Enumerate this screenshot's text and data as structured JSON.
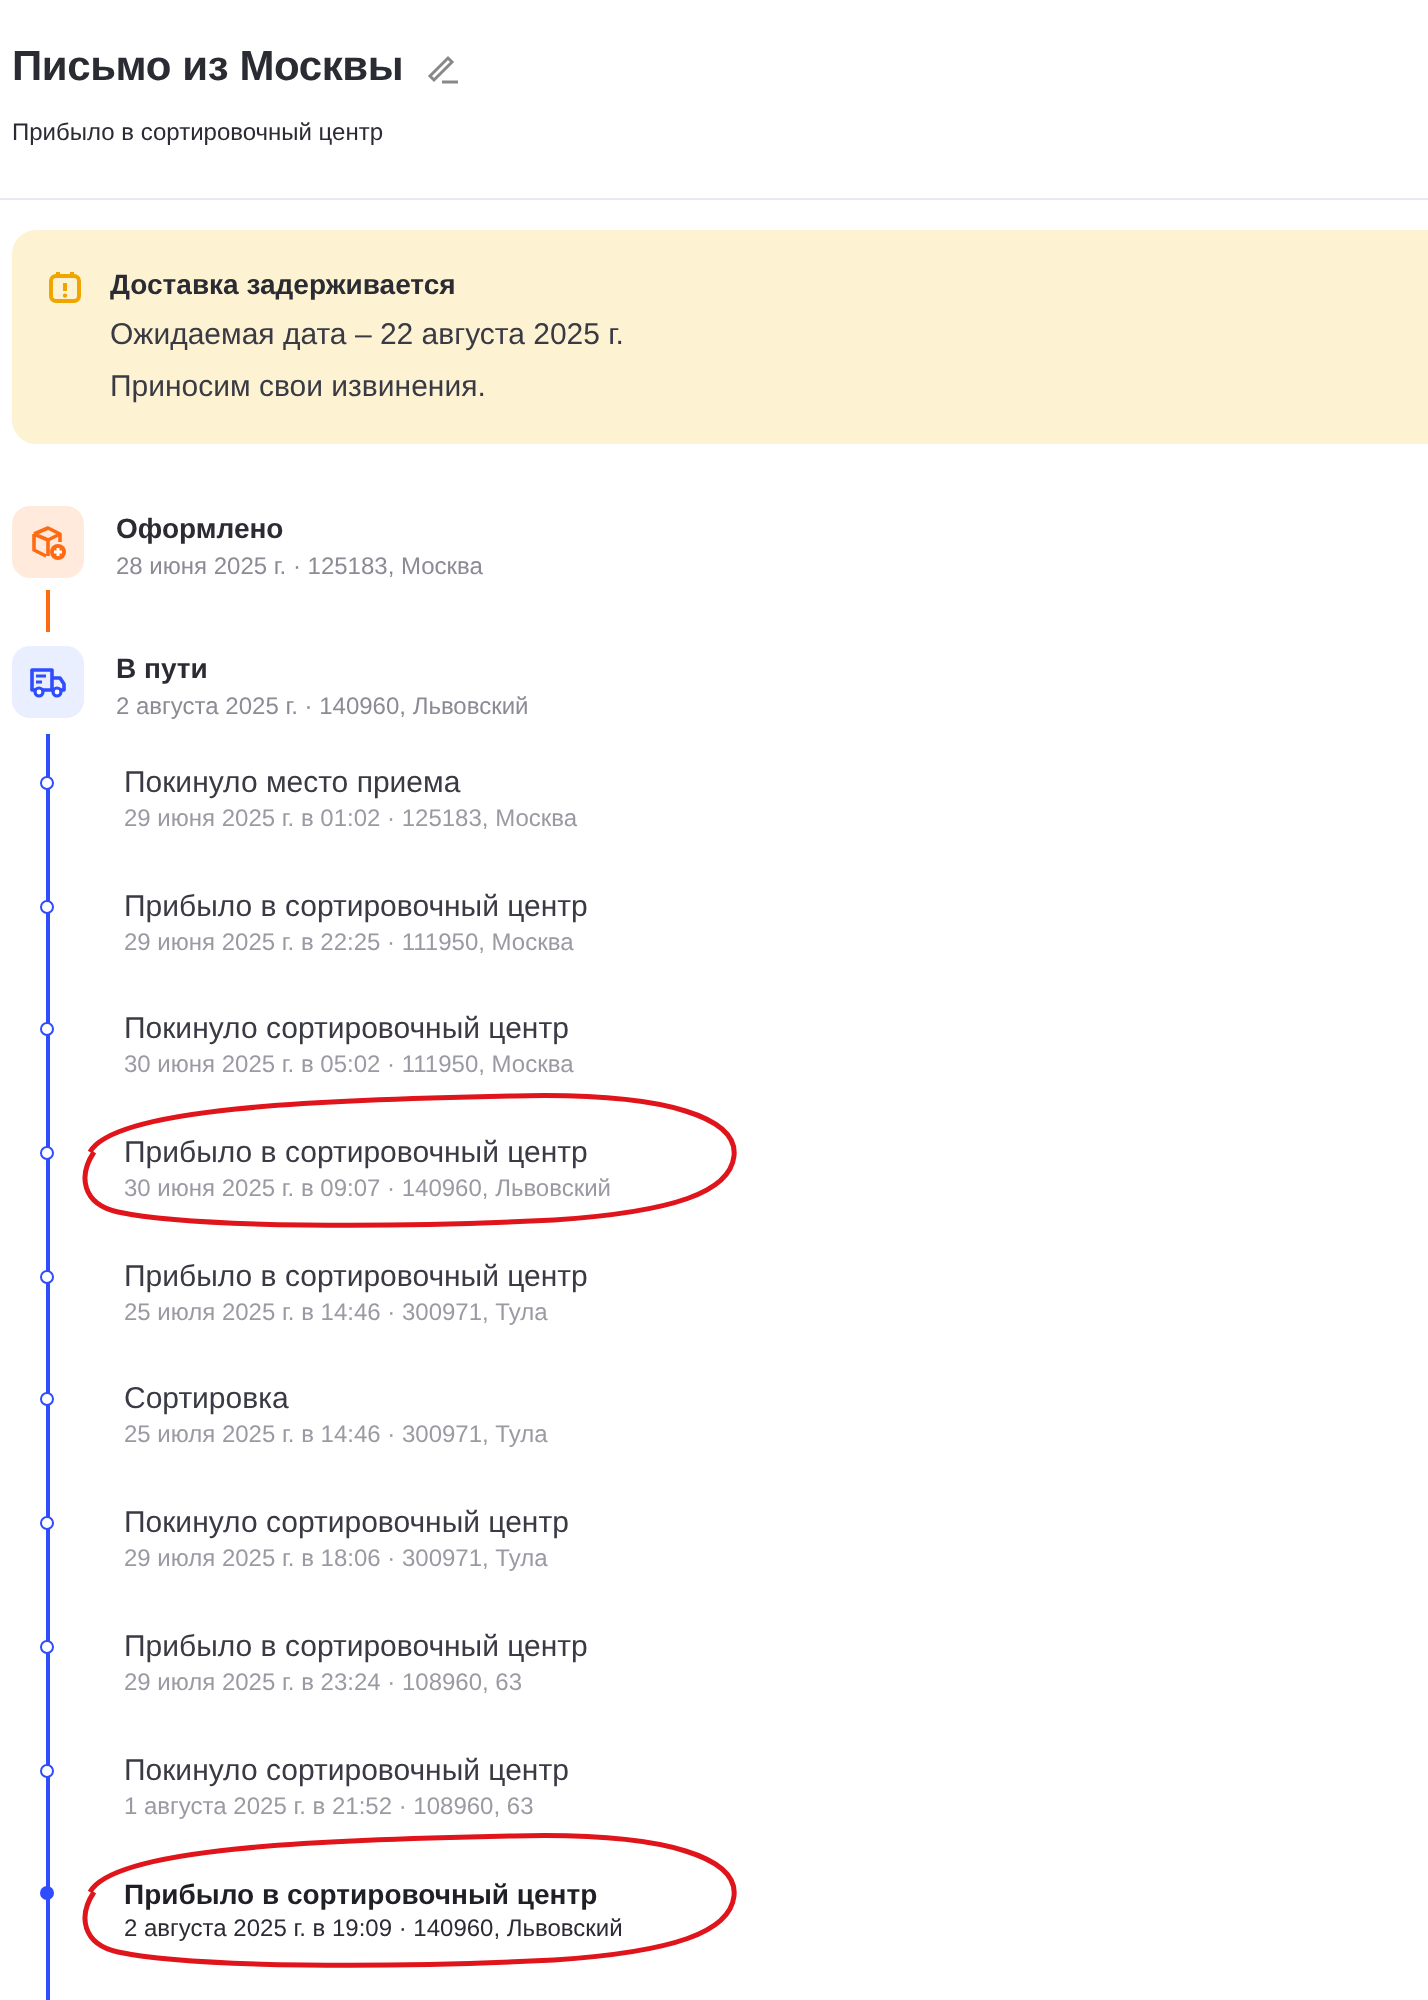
{
  "header": {
    "title": "Письмо из Москвы",
    "subtitle": "Прибыло в сортировочный центр"
  },
  "alert": {
    "title": "Доставка задерживается",
    "lines": [
      "Ожидаемая дата – 22 августа 2025 г.",
      "Приносим свои извинения."
    ]
  },
  "stages": [
    {
      "kind": "created",
      "title": "Оформлено",
      "details": "28 июня 2025 г. · 125183, Москва"
    },
    {
      "kind": "transit",
      "title": "В пути",
      "details": "2 августа 2025 г. · 140960, Львовский"
    }
  ],
  "events": [
    {
      "title": "Покинуло место приема",
      "details": "29 июня 2025 г. в 01:02 · 125183, Москва",
      "current": false,
      "circled": false
    },
    {
      "title": "Прибыло в сортировочный центр",
      "details": "29 июня 2025 г. в 22:25 · 111950, Москва",
      "current": false,
      "circled": false
    },
    {
      "title": "Покинуло сортировочный центр",
      "details": "30 июня 2025 г. в 05:02 · 111950, Москва",
      "current": false,
      "circled": false
    },
    {
      "title": "Прибыло в сортировочный центр",
      "details": "30 июня 2025 г. в 09:07 · 140960, Львовский",
      "current": false,
      "circled": true
    },
    {
      "title": "Прибыло в сортировочный центр",
      "details": "25 июля 2025 г. в 14:46 · 300971, Тула",
      "current": false,
      "circled": false
    },
    {
      "title": "Сортировка",
      "details": "25 июля 2025 г. в 14:46 · 300971, Тула",
      "current": false,
      "circled": false
    },
    {
      "title": "Покинуло сортировочный центр",
      "details": "29 июля 2025 г. в 18:06 · 300971, Тула",
      "current": false,
      "circled": false
    },
    {
      "title": "Прибыло в сортировочный центр",
      "details": "29 июля 2025 г. в 23:24 · 108960, 63",
      "current": false,
      "circled": false
    },
    {
      "title": "Покинуло сортировочный центр",
      "details": "1 августа 2025 г. в 21:52 · 108960, 63",
      "current": false,
      "circled": false
    },
    {
      "title": "Прибыло в сортировочный центр",
      "details": "2 августа 2025 г. в 19:09 · 140960, Львовский",
      "current": true,
      "circled": true
    }
  ]
}
